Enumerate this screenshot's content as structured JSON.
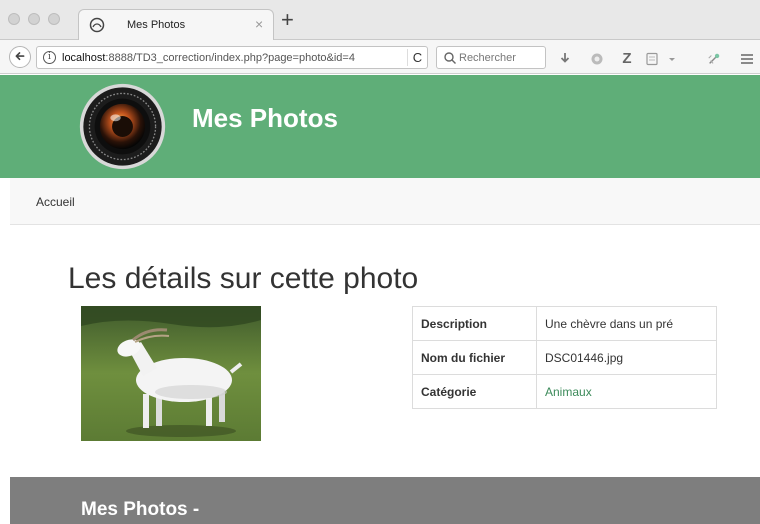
{
  "browser": {
    "tab_title": "Mes Photos",
    "tab_close": "×",
    "new_tab": "+",
    "url_host": "localhost",
    "url_rest": ":8888/TD3_correction/index.php?page=photo&id=4",
    "search_placeholder": "Rechercher",
    "reload_glyph": "C"
  },
  "site": {
    "title": "Mes Photos",
    "brand_color": "#5fae78"
  },
  "menu": {
    "items": [
      {
        "label": "Accueil"
      }
    ]
  },
  "page": {
    "heading": "Les détails sur cette photo",
    "details": [
      {
        "label": "Description",
        "value": "Une chèvre dans un pré"
      },
      {
        "label": "Nom du fichier",
        "value": "DSC01446.jpg"
      },
      {
        "label": "Catégorie",
        "value": "Animaux"
      }
    ]
  },
  "footer": {
    "title": "Mes Photos -"
  }
}
